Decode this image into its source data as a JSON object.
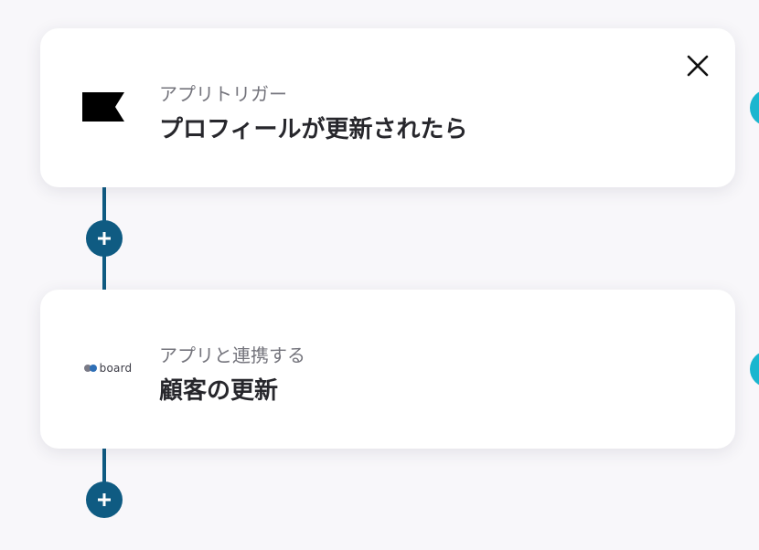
{
  "flow": {
    "steps": [
      {
        "type_label": "アプリトリガー",
        "title": "プロフィールが更新されたら",
        "icon": "flag-icon"
      },
      {
        "type_label": "アプリと連携する",
        "title": "顧客の更新",
        "icon": "board-logo",
        "logo_text": "board"
      }
    ]
  },
  "colors": {
    "background": "#f8f7fa",
    "connector": "#0f5b82",
    "handle": "#1ab6cf",
    "title": "#27272c",
    "subtitle": "#74747c"
  }
}
